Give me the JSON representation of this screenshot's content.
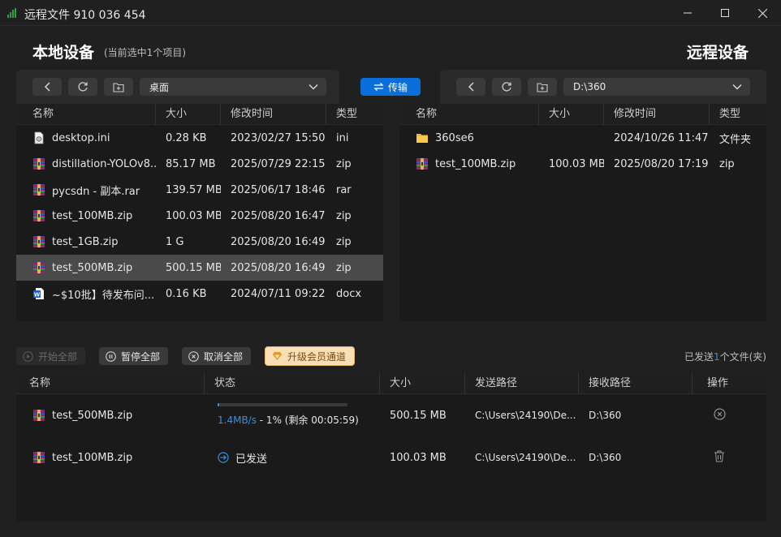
{
  "window": {
    "title": "远程文件 910 036 454",
    "controls": {
      "minimize": "minimize-icon",
      "maximize": "maximize-icon",
      "close": "close-icon"
    },
    "signal_icon_color": "#2ea043"
  },
  "local": {
    "heading": "本地设备",
    "selection_note": "(当前选中1个项目)",
    "path": "桌面",
    "columns": [
      "名称",
      "大小",
      "修改时间",
      "类型"
    ],
    "files": [
      {
        "name": "desktop.ini",
        "size": "0.28 KB",
        "modified": "2023/02/27 15:50",
        "type": "ini",
        "icon": "ini-file-icon"
      },
      {
        "name": "distillation-YOLOv8....",
        "size": "85.17 MB",
        "modified": "2025/07/29 22:15",
        "type": "zip",
        "icon": "archive-file-icon"
      },
      {
        "name": "pycsdn - 副本.rar",
        "size": "139.57 MB",
        "modified": "2025/06/17 18:46",
        "type": "rar",
        "icon": "archive-file-icon"
      },
      {
        "name": "test_100MB.zip",
        "size": "100.03 MB",
        "modified": "2025/08/20 16:47",
        "type": "zip",
        "icon": "archive-file-icon"
      },
      {
        "name": "test_1GB.zip",
        "size": "1 G",
        "modified": "2025/08/20 16:49",
        "type": "zip",
        "icon": "archive-file-icon"
      },
      {
        "name": "test_500MB.zip",
        "size": "500.15 MB",
        "modified": "2025/08/20 16:49",
        "type": "zip",
        "icon": "archive-file-icon",
        "selected": true
      },
      {
        "name": "~$10批】待发布问...",
        "size": "0.16 KB",
        "modified": "2024/07/11 09:22",
        "type": "docx",
        "icon": "word-file-icon"
      }
    ]
  },
  "transfer_button": "传输",
  "remote": {
    "heading": "远程设备",
    "path": "D:\\360",
    "columns": [
      "名称",
      "大小",
      "修改时间",
      "类型"
    ],
    "files": [
      {
        "name": "360se6",
        "size": "",
        "modified": "2024/10/26 11:47",
        "type": "文件夹",
        "icon": "folder-icon"
      },
      {
        "name": "test_100MB.zip",
        "size": "100.03 MB",
        "modified": "2025/08/20 17:19",
        "type": "zip",
        "icon": "archive-file-icon"
      }
    ]
  },
  "queue": {
    "buttons": {
      "start_all": "开始全部",
      "pause_all": "暂停全部",
      "cancel_all": "取消全部",
      "upgrade": "升级会员通道"
    },
    "summary": {
      "prefix": "已发送",
      "count": "1",
      "suffix": "个文件(夹)"
    },
    "columns": [
      "名称",
      "状态",
      "大小",
      "发送路径",
      "接收路径",
      "操作"
    ],
    "tasks": [
      {
        "name": "test_500MB.zip",
        "speed": "1.4MB/s",
        "status_text": " - 1% (剩余 00:05:59)",
        "progress": 0.01,
        "size": "500.15 MB",
        "from": "C:\\Users\\24190\\De...",
        "to": "D:\\360",
        "action": "cancel-circle-icon"
      },
      {
        "name": "test_100MB.zip",
        "status_text": "已发送",
        "size": "100.03 MB",
        "from": "C:\\Users\\24190\\De...",
        "to": "D:\\360",
        "action": "trash-icon"
      }
    ]
  },
  "colors": {
    "accent": "#0a6fd8",
    "progress": "#3c8fe0",
    "vip_bg": "#f9dfb6",
    "selected_row": "#4a4a4a"
  }
}
